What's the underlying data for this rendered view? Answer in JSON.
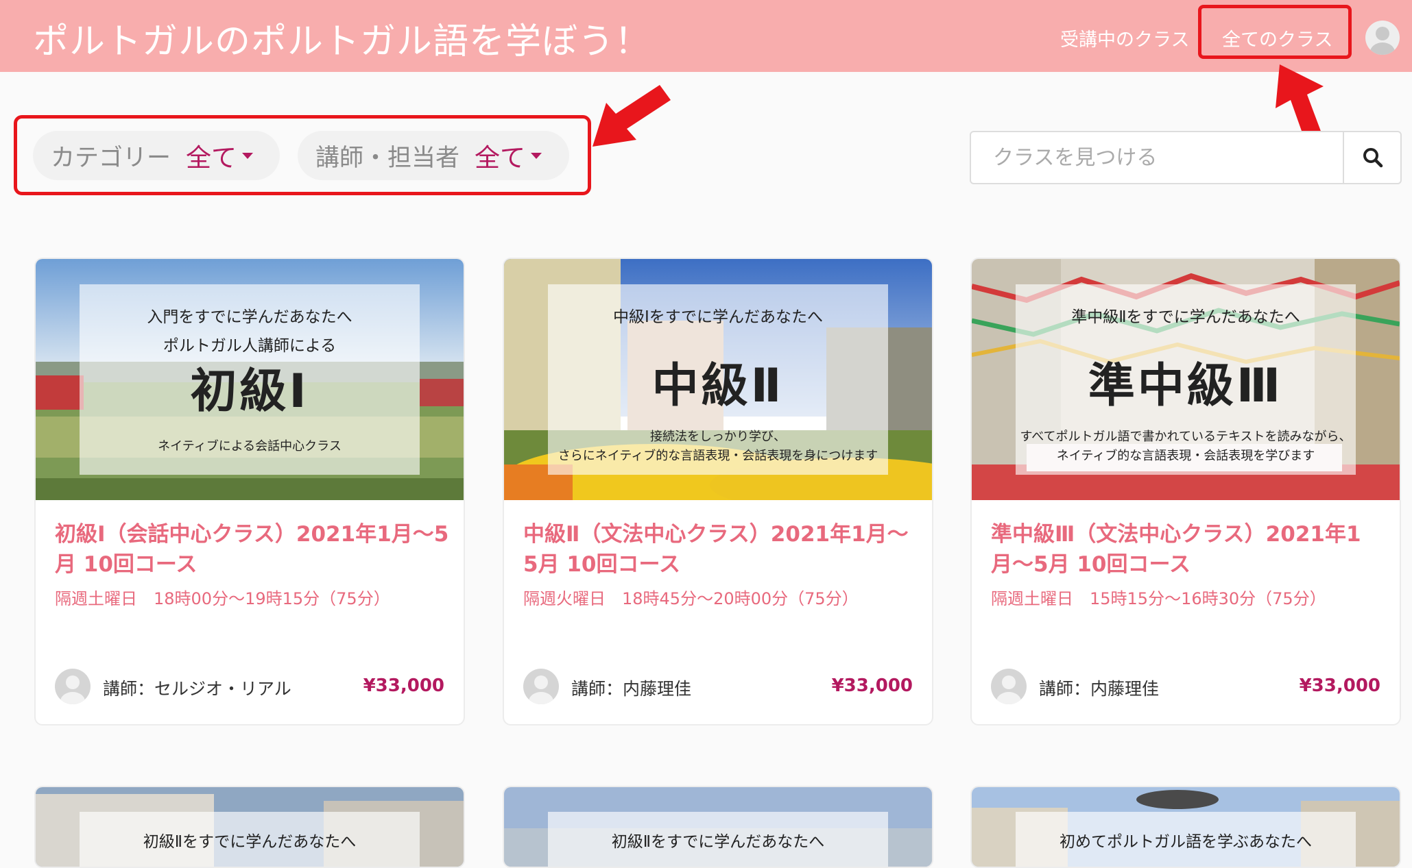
{
  "header": {
    "site_title": "ポルトガルのポルトガル語を学ぼう！",
    "nav": {
      "current_classes": "受講中のクラス",
      "all_classes": "全てのクラス"
    }
  },
  "filters": {
    "category": {
      "label": "カテゴリー",
      "value": "全て"
    },
    "teacher": {
      "label": "講師・担当者",
      "value": "全て"
    }
  },
  "search": {
    "placeholder": "クラスを見つける"
  },
  "courses": [
    {
      "overlay": {
        "line1": "入門をすでに学んだあなたへ",
        "line2": "ポルトガル人講師による",
        "big": "初級Ⅰ",
        "line3": "ネイティブによる会話中心クラス"
      },
      "title": "初級Ⅰ（会話中心クラス）2021年1月〜5月 10回コース",
      "schedule": "隔週土曜日　18時00分〜19時15分（75分）",
      "teacher": "講師：セルジオ・リアル",
      "price": "¥33,000"
    },
    {
      "overlay": {
        "line1": "中級Ⅰをすでに学んだあなたへ",
        "big": "中級Ⅱ",
        "line2": "接続法をしっかり学び、",
        "line3": "さらにネイティブ的な言語表現・会話表現を身につけます"
      },
      "title": "中級Ⅱ（文法中心クラス）2021年1月〜5月 10回コース",
      "schedule": "隔週火曜日　18時45分〜20時00分（75分）",
      "teacher": "講師：内藤理佳",
      "price": "¥33,000"
    },
    {
      "overlay": {
        "line1": "準中級Ⅱをすでに学んだあなたへ",
        "big": "準中級Ⅲ",
        "line2": "すべてポルトガル語で書かれているテキストを読みながら、",
        "line3": "ネイティブ的な言語表現・会話表現を学びます"
      },
      "title": "準中級Ⅲ（文法中心クラス）2021年1月〜5月 10回コース",
      "schedule": "隔週土曜日　15時15分〜16時30分（75分）",
      "teacher": "講師：内藤理佳",
      "price": "¥33,000"
    }
  ],
  "courses_row2": [
    {
      "overlay_text": "初級Ⅱをすでに学んだあなたへ"
    },
    {
      "overlay_text": "初級Ⅱをすでに学んだあなたへ"
    },
    {
      "overlay_text": "初めてポルトガル語を学ぶあなたへ"
    }
  ],
  "icons": {
    "search": "search-icon",
    "user": "user-avatar-icon",
    "dropdown": "caret-down-icon"
  },
  "colors": {
    "header_bg": "#f8adad",
    "accent": "#b3195f",
    "course_title": "#e8697d",
    "highlight": "#e8161c"
  }
}
